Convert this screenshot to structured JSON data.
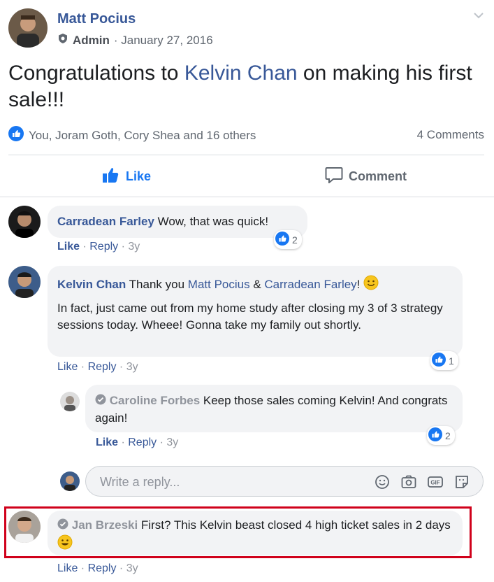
{
  "post": {
    "author": "Matt Pocius",
    "role": "Admin",
    "date": "· January 27, 2016",
    "text_before": "Congratulations to ",
    "mention": "Kelvin Chan",
    "text_after": " on making his first sale!!!",
    "reactions_summary": "You, Joram Goth, Cory Shea and 16 others",
    "comments_count": "4 Comments"
  },
  "actions": {
    "like": "Like",
    "comment": "Comment"
  },
  "comments": [
    {
      "name": "Carradean Farley",
      "text": " Wow, that was quick!",
      "like": "Like",
      "reply": "Reply",
      "time": "3y",
      "reaction_count": "2"
    },
    {
      "name": "Kelvin Chan",
      "text_a": " Thank you ",
      "mention1": "Matt Pocius",
      "text_b": " & ",
      "mention2": "Carradean Farley",
      "text_c": "! ",
      "text_para": "In fact, just came out from my home study after closing my 3 of 3 strategy sessions today. Wheee! Gonna take my family out shortly.",
      "like": "Like",
      "reply": "Reply",
      "time": "3y",
      "reaction_count": "1"
    },
    {
      "name": "Caroline Forbes",
      "text": " Keep those sales coming Kelvin! And congrats again!",
      "like": "Like",
      "reply": "Reply",
      "time": "3y",
      "reaction_count": "2"
    },
    {
      "name": "Jan Brzeski",
      "text": " First? This Kelvin beast closed 4 high ticket sales in 2 days ",
      "like": "Like",
      "reply": "Reply",
      "time": "3y"
    }
  ],
  "reply_box": {
    "placeholder": "Write a reply..."
  },
  "colors": {
    "link": "#385898",
    "like_blue": "#1877f2",
    "highlight": "#d0011b",
    "bubble": "#f2f3f5"
  },
  "icons": [
    "chevron-down-icon",
    "admin-badge-icon",
    "like-reaction-icon",
    "thumbs-up-icon",
    "comment-icon",
    "smile-emoji-icon",
    "emoji-icon",
    "camera-icon",
    "gif-icon",
    "sticker-icon",
    "verified-badge-icon"
  ]
}
